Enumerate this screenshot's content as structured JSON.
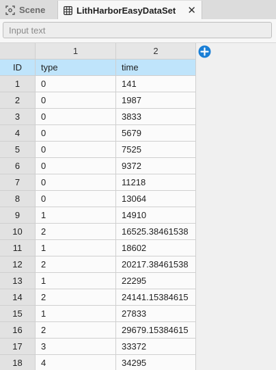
{
  "tabs": [
    {
      "label": "Scene",
      "icon": "scene-icon"
    },
    {
      "label": "LithHarborEasyDataSet",
      "icon": "grid-table-icon",
      "active": true
    }
  ],
  "search": {
    "placeholder": "Input text",
    "value": ""
  },
  "grid": {
    "column_numbers": [
      "1",
      "2"
    ],
    "headers": {
      "id": "ID",
      "col1": "type",
      "col2": "time"
    },
    "rows": [
      {
        "id": "1",
        "type": "0",
        "time": "141"
      },
      {
        "id": "2",
        "type": "0",
        "time": "1987"
      },
      {
        "id": "3",
        "type": "0",
        "time": "3833"
      },
      {
        "id": "4",
        "type": "0",
        "time": "5679"
      },
      {
        "id": "5",
        "type": "0",
        "time": "7525"
      },
      {
        "id": "6",
        "type": "0",
        "time": "9372"
      },
      {
        "id": "7",
        "type": "0",
        "time": "11218"
      },
      {
        "id": "8",
        "type": "0",
        "time": "13064"
      },
      {
        "id": "9",
        "type": "1",
        "time": "14910"
      },
      {
        "id": "10",
        "type": "2",
        "time": "16525.38461538"
      },
      {
        "id": "11",
        "type": "1",
        "time": "18602"
      },
      {
        "id": "12",
        "type": "2",
        "time": "20217.38461538"
      },
      {
        "id": "13",
        "type": "1",
        "time": "22295"
      },
      {
        "id": "14",
        "type": "2",
        "time": "24141.15384615"
      },
      {
        "id": "15",
        "type": "1",
        "time": "27833"
      },
      {
        "id": "16",
        "type": "2",
        "time": "29679.15384615"
      },
      {
        "id": "17",
        "type": "3",
        "time": "33372"
      },
      {
        "id": "18",
        "type": "4",
        "time": "34295"
      }
    ]
  },
  "colors": {
    "header_bg": "#bfe4fb",
    "add_button": "#1a7fd6"
  }
}
